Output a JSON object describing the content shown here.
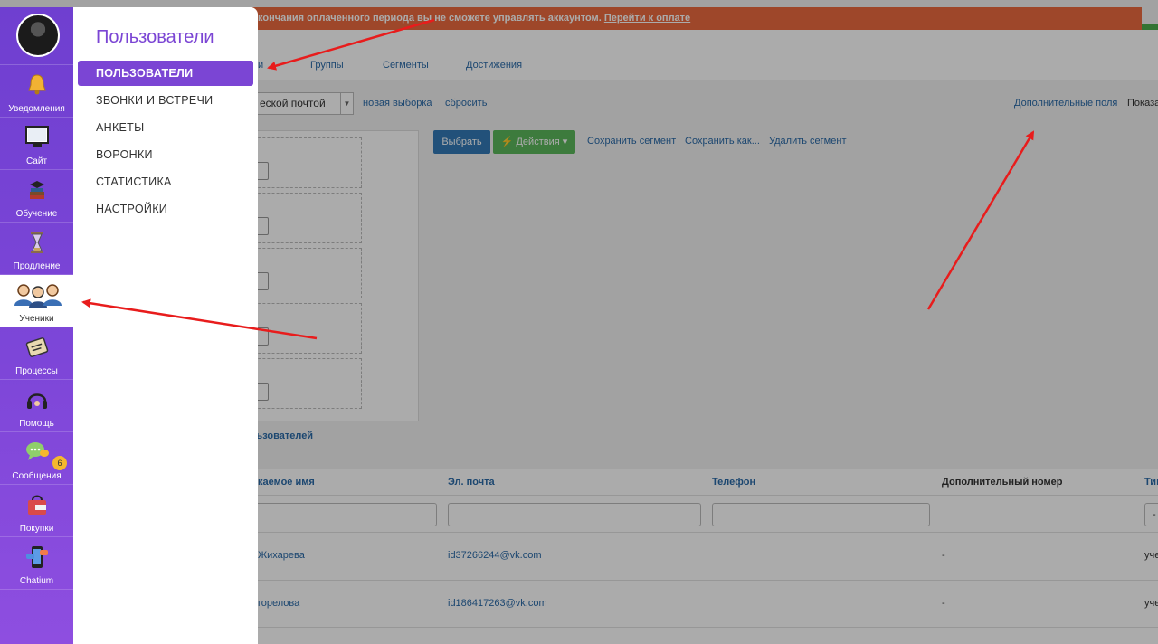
{
  "banner": {
    "text": "кончания оплаченного периода вы не сможете управлять аккаунтом.",
    "link": "Перейти к оплате"
  },
  "plus_label": "+",
  "tabs": [
    {
      "label": "и"
    },
    {
      "label": "Группы"
    },
    {
      "label": "Сегменты"
    },
    {
      "label": "Достижения"
    }
  ],
  "filter": {
    "select_value": "еской почтой",
    "new_selection": "новая выборка",
    "reset": "сбросить",
    "extra_fields": "Дополнительные поля",
    "show": "Показа"
  },
  "actions": {
    "select_btn": "Выбрать",
    "actions_btn": "⚡ Действия ▾",
    "save_segment": "Сохранить сегмент",
    "save_as": "Сохранить как...",
    "delete_segment": "Удалить сегмент"
  },
  "users_count": "ользователей",
  "table": {
    "headers": [
      "каемое имя",
      "Эл. почта",
      "Телефон",
      "Дополнительный номер",
      "Тип"
    ],
    "rows": [
      {
        "name": "Жихарева",
        "email": "id37266244@vk.com",
        "extra": "-",
        "type": "уче"
      },
      {
        "name": "горелова",
        "email": "id186417263@vk.com",
        "extra": "-",
        "type": "уче"
      }
    ],
    "type_filter": "-"
  },
  "sidebar": {
    "items": [
      {
        "label": "Уведомления",
        "icon": "bell-icon"
      },
      {
        "label": "Сайт",
        "icon": "monitor-icon"
      },
      {
        "label": "Обучение",
        "icon": "books-icon"
      },
      {
        "label": "Продление",
        "icon": "hourglass-icon"
      },
      {
        "label": "Ученики",
        "icon": "users-icon"
      },
      {
        "label": "Процессы",
        "icon": "process-icon"
      },
      {
        "label": "Помощь",
        "icon": "headset-icon"
      },
      {
        "label": "Сообщения",
        "icon": "chat-icon",
        "badge": "6"
      },
      {
        "label": "Покупки",
        "icon": "bag-icon"
      },
      {
        "label": "Chatium",
        "icon": "phone-icon"
      }
    ]
  },
  "submenu": {
    "title": "Пользователи",
    "items": [
      {
        "label": "ПОЛЬЗОВАТЕЛИ"
      },
      {
        "label": "ЗВОНКИ И ВСТРЕЧИ"
      },
      {
        "label": "АНКЕТЫ"
      },
      {
        "label": "ВОРОНКИ"
      },
      {
        "label": "СТАТИСТИКА"
      },
      {
        "label": "НАСТРОЙКИ"
      }
    ]
  },
  "colors": {
    "accent": "#7b45d4",
    "banner": "#ec6b3f",
    "primary": "#337ab7",
    "success": "#5cb85c",
    "arrow": "#e81c1c"
  }
}
